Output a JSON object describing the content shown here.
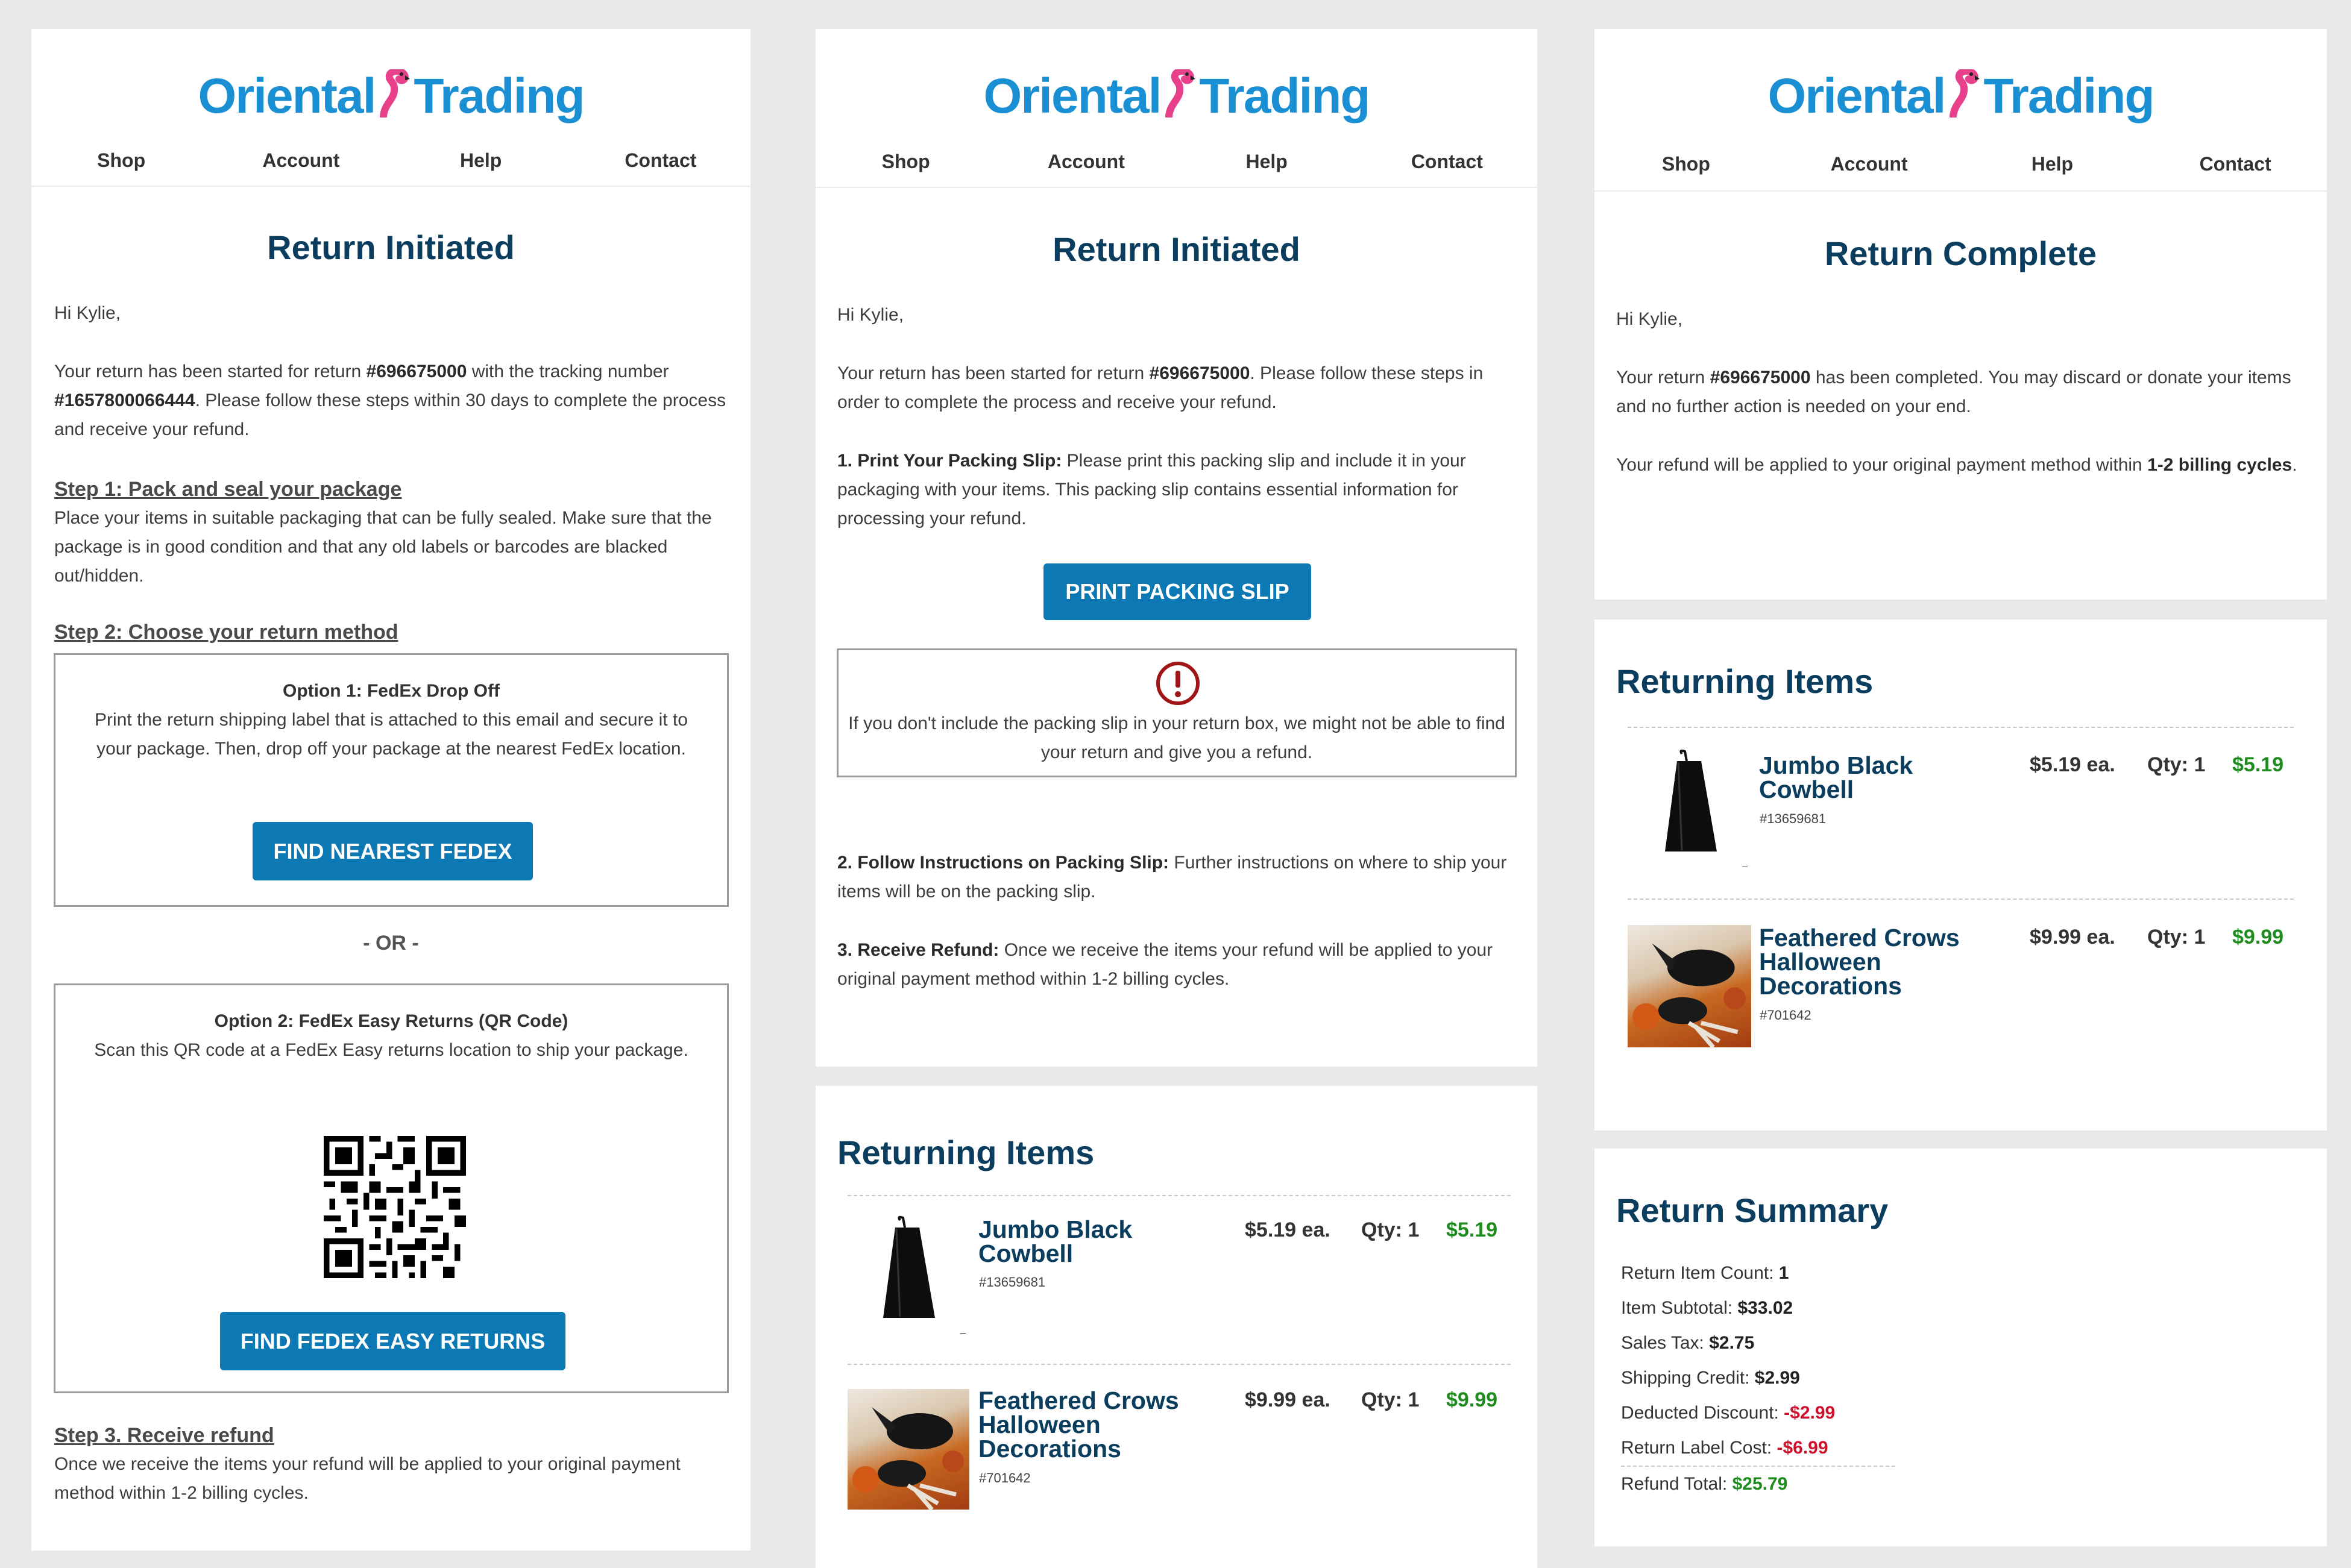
{
  "brand": {
    "logo_text_1": "Oriental",
    "logo_text_2": "Trading"
  },
  "nav": {
    "shop": "Shop",
    "account": "Account",
    "help": "Help",
    "contact": "Contact"
  },
  "email1": {
    "title": "Return Initiated",
    "greeting": "Hi Kylie,",
    "intro_1": "Your return has been started for return ",
    "return_no": "#696675000",
    "intro_2": " with the tracking number",
    "tracking_no": "#1657800066444",
    "intro_3": ". Please follow these steps within 30 days to complete the process and receive your refund.",
    "step1_heading": "Step 1: Pack and seal your package",
    "step1_text": "Place your items in suitable packaging that can be fully sealed. Make sure that the package is in good condition and that any old labels or barcodes are blacked out/hidden.",
    "step2_heading": "Step 2: Choose your return method",
    "option1_title": "Option 1: FedEx Drop Off",
    "option1_text": "Print the return shipping label that is attached to this email and secure it to your package. Then, drop off your package at the nearest FedEx location.",
    "option1_button": "FIND NEAREST FEDEX",
    "or_text": "- OR -",
    "option2_title": "Option 2: FedEx Easy Returns (QR Code)",
    "option2_text": "Scan this QR code at a FedEx Easy returns location to ship your package.",
    "option2_button": "FIND FEDEX EASY RETURNS",
    "step3_heading": "Step 3. Receive refund",
    "step3_text": "Once we receive the items your refund will be applied to your original payment method within 1-2 billing cycles."
  },
  "email2": {
    "title": "Return Initiated",
    "greeting": "Hi Kylie,",
    "intro_1": "Your return has been started for return ",
    "return_no": "#696675000",
    "intro_2": ". Please follow these steps in order to complete the process and receive your refund.",
    "step1_heading": "1. Print Your Packing Slip:",
    "step1_text": " Please print this packing slip and include it in your packaging with your items. This packing slip contains essential information for processing your refund.",
    "print_button": "PRINT PACKING SLIP",
    "warning_text": "If you don't include the packing slip in your return box, we might not be able to find your return and give you a refund.",
    "step2_heading": "2. Follow Instructions on Packing Slip:",
    "step2_text": " Further instructions on where to ship your items will be on the packing slip.",
    "step3_heading": "3. Receive Refund:",
    "step3_text": " Once we receive the items your refund will be applied to your original payment method within 1-2 billing cycles.",
    "returning_title": "Returning Items"
  },
  "email3": {
    "title": "Return Complete",
    "greeting": "Hi Kylie,",
    "body_1": "Your return ",
    "return_no": "#696675000",
    "body_2": " has been completed. You may discard or donate your items and no further action is needed on your end.",
    "refund_1": "Your refund will be applied to your original payment method within ",
    "refund_bold": "1-2 billing cycles",
    "refund_2": ".",
    "returning_title": "Returning Items",
    "summary_title": "Return Summary",
    "summary": {
      "count_label": "Return Item Count: ",
      "count": "1",
      "subtotal_label": "Item Subtotal: ",
      "subtotal": "$33.02",
      "tax_label": "Sales Tax: ",
      "tax": "$2.75",
      "shipping_label": "Shipping Credit: ",
      "shipping": "$2.99",
      "discount_label": "Deducted Discount: ",
      "discount": "-$2.99",
      "label_cost_label": "Return Label Cost: ",
      "label_cost": "-$6.99",
      "refund_label": "Refund Total: ",
      "refund": "$25.79"
    }
  },
  "items": [
    {
      "name": "Jumbo Black Cowbell",
      "sku": "#13659681",
      "price": "$5.19 ea.",
      "qty": "Qty: 1",
      "total": "$5.19",
      "marker": "_"
    },
    {
      "name": "Feathered Crows Halloween Decorations",
      "sku": "#701642",
      "price": "$9.99 ea.",
      "qty": "Qty: 1",
      "total": "$9.99"
    }
  ],
  "colors": {
    "brand_blue": "#1b8fd3",
    "heading_navy": "#0b3d5e",
    "button_blue": "#0c78b4",
    "price_green": "#1e8b1e",
    "negative_red": "#d0102a",
    "warning_red": "#a01515"
  },
  "icons": {
    "warning": "exclamation-circle-icon",
    "qr": "qr-code-icon",
    "logo_mascot": "flamingo-icon"
  }
}
